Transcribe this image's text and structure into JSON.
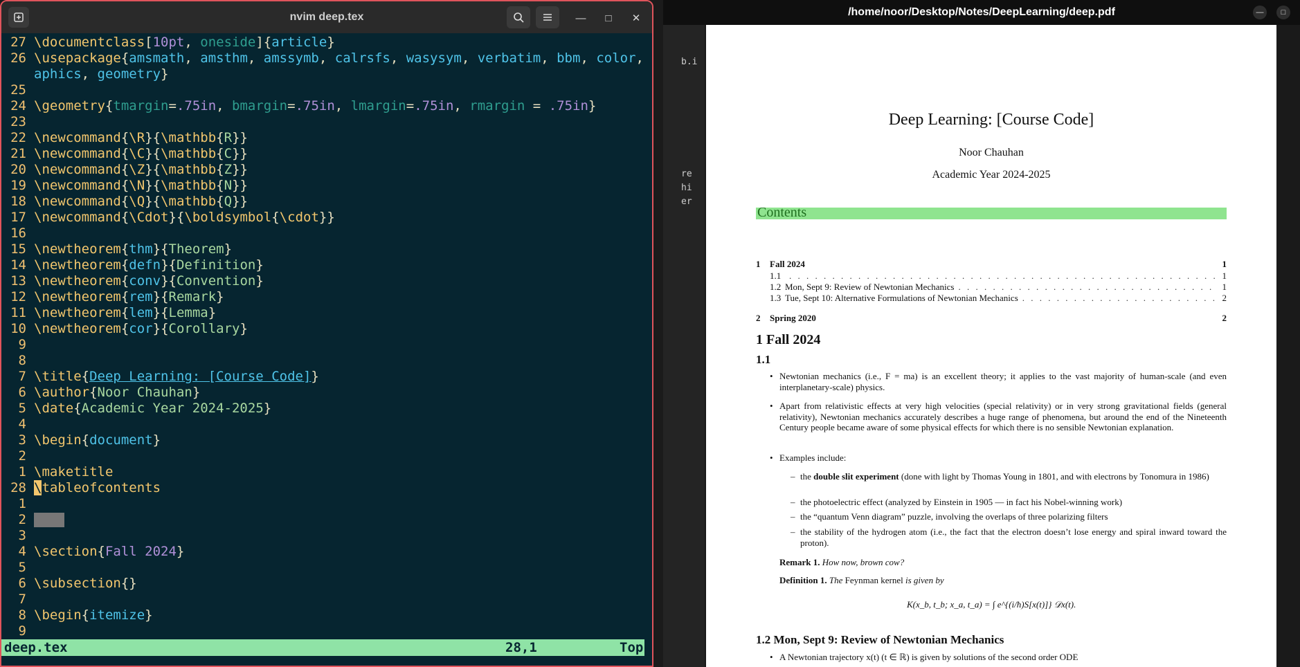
{
  "terminal": {
    "title": "nvim deep.tex",
    "lines": [
      {
        "ln": "27",
        "segs": [
          [
            "kw",
            "\\documentclass"
          ],
          [
            "br",
            "["
          ],
          [
            "opt",
            "10pt"
          ],
          [
            "br",
            ", "
          ],
          [
            "key",
            "oneside"
          ],
          [
            "br",
            "]{"
          ],
          [
            "arg",
            "article"
          ],
          [
            "br",
            "}"
          ]
        ]
      },
      {
        "ln": "26",
        "segs": [
          [
            "kw",
            "\\usepackage"
          ],
          [
            "br",
            "{"
          ],
          [
            "arg",
            "amsmath"
          ],
          [
            "br",
            ", "
          ],
          [
            "arg",
            "amsthm"
          ],
          [
            "br",
            ", "
          ],
          [
            "arg",
            "amssymb"
          ],
          [
            "br",
            ", "
          ],
          [
            "arg",
            "calrsfs"
          ],
          [
            "br",
            ", "
          ],
          [
            "arg",
            "wasysym"
          ],
          [
            "br",
            ", "
          ],
          [
            "arg",
            "verbatim"
          ],
          [
            "br",
            ", "
          ],
          [
            "arg",
            "bbm"
          ],
          [
            "br",
            ", "
          ],
          [
            "arg",
            "color"
          ],
          [
            "br",
            ", "
          ],
          [
            "arg",
            "gr"
          ]
        ]
      },
      {
        "ln": "",
        "segs": [
          [
            "arg",
            "aphics"
          ],
          [
            "br",
            ", "
          ],
          [
            "arg",
            "geometry"
          ],
          [
            "br",
            "}"
          ]
        ]
      },
      {
        "ln": "25",
        "segs": []
      },
      {
        "ln": "24",
        "segs": [
          [
            "kw",
            "\\geometry"
          ],
          [
            "br",
            "{"
          ],
          [
            "key",
            "tmargin"
          ],
          [
            "br",
            "="
          ],
          [
            "opt",
            ".75in"
          ],
          [
            "br",
            ", "
          ],
          [
            "key",
            "bmargin"
          ],
          [
            "br",
            "="
          ],
          [
            "opt",
            ".75in"
          ],
          [
            "br",
            ", "
          ],
          [
            "key",
            "lmargin"
          ],
          [
            "br",
            "="
          ],
          [
            "opt",
            ".75in"
          ],
          [
            "br",
            ", "
          ],
          [
            "key",
            "rmargin"
          ],
          [
            "br",
            " = "
          ],
          [
            "opt",
            ".75in"
          ],
          [
            "br",
            "}"
          ]
        ]
      },
      {
        "ln": "23",
        "segs": []
      },
      {
        "ln": "22",
        "segs": [
          [
            "kw",
            "\\newcommand"
          ],
          [
            "br",
            "{"
          ],
          [
            "kw",
            "\\R"
          ],
          [
            "br",
            "}{"
          ],
          [
            "kw",
            "\\mathbb"
          ],
          [
            "br",
            "{"
          ],
          [
            "txt",
            "R"
          ],
          [
            "br",
            "}}"
          ]
        ]
      },
      {
        "ln": "21",
        "segs": [
          [
            "kw",
            "\\newcommand"
          ],
          [
            "br",
            "{"
          ],
          [
            "kw",
            "\\C"
          ],
          [
            "br",
            "}{"
          ],
          [
            "kw",
            "\\mathbb"
          ],
          [
            "br",
            "{"
          ],
          [
            "txt",
            "C"
          ],
          [
            "br",
            "}}"
          ]
        ]
      },
      {
        "ln": "20",
        "segs": [
          [
            "kw",
            "\\newcommand"
          ],
          [
            "br",
            "{"
          ],
          [
            "kw",
            "\\Z"
          ],
          [
            "br",
            "}{"
          ],
          [
            "kw",
            "\\mathbb"
          ],
          [
            "br",
            "{"
          ],
          [
            "txt",
            "Z"
          ],
          [
            "br",
            "}}"
          ]
        ]
      },
      {
        "ln": "19",
        "segs": [
          [
            "kw",
            "\\newcommand"
          ],
          [
            "br",
            "{"
          ],
          [
            "kw",
            "\\N"
          ],
          [
            "br",
            "}{"
          ],
          [
            "kw",
            "\\mathbb"
          ],
          [
            "br",
            "{"
          ],
          [
            "txt",
            "N"
          ],
          [
            "br",
            "}}"
          ]
        ]
      },
      {
        "ln": "18",
        "segs": [
          [
            "kw",
            "\\newcommand"
          ],
          [
            "br",
            "{"
          ],
          [
            "kw",
            "\\Q"
          ],
          [
            "br",
            "}{"
          ],
          [
            "kw",
            "\\mathbb"
          ],
          [
            "br",
            "{"
          ],
          [
            "txt",
            "Q"
          ],
          [
            "br",
            "}}"
          ]
        ]
      },
      {
        "ln": "17",
        "segs": [
          [
            "kw",
            "\\newcommand"
          ],
          [
            "br",
            "{"
          ],
          [
            "kw",
            "\\Cdot"
          ],
          [
            "br",
            "}{"
          ],
          [
            "kw",
            "\\boldsymbol"
          ],
          [
            "br",
            "{"
          ],
          [
            "kw",
            "\\cdot"
          ],
          [
            "br",
            "}}"
          ]
        ]
      },
      {
        "ln": "16",
        "segs": []
      },
      {
        "ln": "15",
        "segs": [
          [
            "kw",
            "\\newtheorem"
          ],
          [
            "br",
            "{"
          ],
          [
            "arg",
            "thm"
          ],
          [
            "br",
            "}{"
          ],
          [
            "txt",
            "Theorem"
          ],
          [
            "br",
            "}"
          ]
        ]
      },
      {
        "ln": "14",
        "segs": [
          [
            "kw",
            "\\newtheorem"
          ],
          [
            "br",
            "{"
          ],
          [
            "arg",
            "defn"
          ],
          [
            "br",
            "}{"
          ],
          [
            "txt",
            "Definition"
          ],
          [
            "br",
            "}"
          ]
        ]
      },
      {
        "ln": "13",
        "segs": [
          [
            "kw",
            "\\newtheorem"
          ],
          [
            "br",
            "{"
          ],
          [
            "arg",
            "conv"
          ],
          [
            "br",
            "}{"
          ],
          [
            "txt",
            "Convention"
          ],
          [
            "br",
            "}"
          ]
        ]
      },
      {
        "ln": "12",
        "segs": [
          [
            "kw",
            "\\newtheorem"
          ],
          [
            "br",
            "{"
          ],
          [
            "arg",
            "rem"
          ],
          [
            "br",
            "}{"
          ],
          [
            "txt",
            "Remark"
          ],
          [
            "br",
            "}"
          ]
        ]
      },
      {
        "ln": "11",
        "segs": [
          [
            "kw",
            "\\newtheorem"
          ],
          [
            "br",
            "{"
          ],
          [
            "arg",
            "lem"
          ],
          [
            "br",
            "}{"
          ],
          [
            "txt",
            "Lemma"
          ],
          [
            "br",
            "}"
          ]
        ]
      },
      {
        "ln": "10",
        "segs": [
          [
            "kw",
            "\\newtheorem"
          ],
          [
            "br",
            "{"
          ],
          [
            "arg",
            "cor"
          ],
          [
            "br",
            "}{"
          ],
          [
            "txt",
            "Corollary"
          ],
          [
            "br",
            "}"
          ]
        ]
      },
      {
        "ln": "9",
        "segs": []
      },
      {
        "ln": "8",
        "segs": []
      },
      {
        "ln": "7",
        "segs": [
          [
            "kw",
            "\\title"
          ],
          [
            "br",
            "{"
          ],
          [
            "lnk",
            "Deep Learning: [Course Code]"
          ],
          [
            "br",
            "}"
          ]
        ]
      },
      {
        "ln": "6",
        "segs": [
          [
            "kw",
            "\\author"
          ],
          [
            "br",
            "{"
          ],
          [
            "txt",
            "Noor Chauhan"
          ],
          [
            "br",
            "}"
          ]
        ]
      },
      {
        "ln": "5",
        "segs": [
          [
            "kw",
            "\\date"
          ],
          [
            "br",
            "{"
          ],
          [
            "txt",
            "Academic Year 2024-2025"
          ],
          [
            "br",
            "}"
          ]
        ]
      },
      {
        "ln": "4",
        "segs": []
      },
      {
        "ln": "3",
        "segs": [
          [
            "kw",
            "\\begin"
          ],
          [
            "br",
            "{"
          ],
          [
            "arg",
            "document"
          ],
          [
            "br",
            "}"
          ]
        ]
      },
      {
        "ln": "2",
        "segs": []
      },
      {
        "ln": "1",
        "segs": [
          [
            "kw",
            "\\maketitle"
          ]
        ]
      },
      {
        "ln": "28",
        "segs": [
          [
            "cursor",
            "\\"
          ],
          [
            "kw",
            "tableofcontents"
          ]
        ]
      },
      {
        "ln": "1",
        "segs": []
      },
      {
        "ln": "2",
        "segs": [
          [
            "sel",
            ""
          ]
        ]
      },
      {
        "ln": "3",
        "segs": []
      },
      {
        "ln": "4",
        "segs": [
          [
            "kw",
            "\\section"
          ],
          [
            "br",
            "{"
          ],
          [
            "opt",
            "Fall 2024"
          ],
          [
            "br",
            "}"
          ]
        ]
      },
      {
        "ln": "5",
        "segs": []
      },
      {
        "ln": "6",
        "segs": [
          [
            "kw",
            "\\subsection"
          ],
          [
            "br",
            "{}"
          ]
        ]
      },
      {
        "ln": "7",
        "segs": []
      },
      {
        "ln": "8",
        "segs": [
          [
            "kw",
            "\\begin"
          ],
          [
            "br",
            "{"
          ],
          [
            "arg",
            "itemize"
          ],
          [
            "br",
            "}"
          ]
        ]
      },
      {
        "ln": "9",
        "segs": []
      }
    ],
    "status": {
      "file": "deep.tex",
      "position": "28,1",
      "scroll": "Top"
    }
  },
  "pdf": {
    "window_title": "/home/noor/Desktop/Notes/DeepLearning/deep.pdf",
    "strip_fragments": [
      "b.i",
      "re",
      "hi",
      "er"
    ],
    "title": "Deep Learning: [Course Code]",
    "author": "Noor Chauhan",
    "date": "Academic Year 2024-2025",
    "contents_heading": "Contents",
    "toc": [
      {
        "num": "1",
        "title": "Fall 2024",
        "page": "1",
        "bold": true
      },
      {
        "num": "1.1",
        "title": "",
        "page": "1",
        "bold": false
      },
      {
        "num": "1.2",
        "title": "Mon, Sept 9: Review of Newtonian Mechanics",
        "page": "1",
        "bold": false
      },
      {
        "num": "1.3",
        "title": "Tue, Sept 10: Alternative Formulations of Newtonian Mechanics",
        "page": "2",
        "bold": false
      },
      {
        "num": "2",
        "title": "Spring 2020",
        "page": "2",
        "bold": true
      }
    ],
    "section1": "1   Fall 2024",
    "subsection11": "1.1",
    "bullets": [
      "Newtonian mechanics (i.e., F = ma) is an excellent theory; it applies to the vast majority of human-scale (and even interplanetary-scale) physics.",
      "Apart from relativistic effects at very high velocities (special relativity) or in very strong gravitational fields (general relativity), Newtonian mechanics accurately describes a huge range of phenomena, but around the end of the Nineteenth Century people became aware of some physical effects for which there is no sensible Newtonian explanation.",
      "Examples include:"
    ],
    "examples": [
      {
        "prefix": "the ",
        "bold": "double slit experiment",
        "rest": " (done with light by Thomas Young in 1801, and with electrons by Tonomura in 1986)"
      },
      {
        "prefix": "the photoelectric effect (analyzed by Einstein in 1905 — in fact his Nobel-winning work)",
        "bold": "",
        "rest": ""
      },
      {
        "prefix": "the “quantum Venn diagram” puzzle, involving the overlaps of three polarizing filters",
        "bold": "",
        "rest": ""
      },
      {
        "prefix": "the stability of the hydrogen atom (i.e., the fact that the electron doesn’t lose energy and spiral inward toward the proton).",
        "bold": "",
        "rest": ""
      }
    ],
    "remark_label": "Remark 1.",
    "remark_text": "How now, brown cow?",
    "definition_label": "Definition 1.",
    "definition_text_a": "The",
    "definition_text_b": "Feynman kernel",
    "definition_text_c": "is given by",
    "equation": "K(x_b, t_b; x_a, t_a) = ∫ e^{(i/ħ)S[x(t)]} 𝒟x(t).",
    "subsection12": "1.2   Mon, Sept 9: Review of Newtonian Mechanics",
    "last_bullet": "A Newtonian trajectory x(t) (t ∈ ℝ) is given by solutions of the second order ODE"
  }
}
